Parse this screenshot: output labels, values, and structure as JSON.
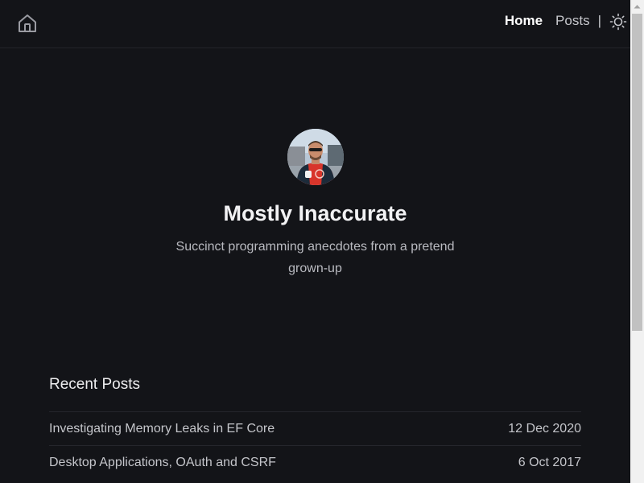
{
  "header": {
    "home_icon": "house-icon",
    "nav": {
      "home_label": "Home",
      "posts_label": "Posts",
      "separator": "|"
    },
    "theme_icon": "sun-icon"
  },
  "hero": {
    "avatar": "profile-photo",
    "title": "Mostly Inaccurate",
    "tagline": "Succinct programming anecdotes from a pretend grown-up"
  },
  "recent_posts": {
    "heading": "Recent Posts",
    "items": [
      {
        "title": "Investigating Memory Leaks in EF Core",
        "date": "12 Dec 2020"
      },
      {
        "title": "Desktop Applications, OAuth and CSRF",
        "date": "6 Oct 2017"
      }
    ]
  },
  "colors": {
    "background": "#131418",
    "text": "#e6e6e8",
    "muted": "#b9bac0",
    "divider": "#25262c"
  }
}
